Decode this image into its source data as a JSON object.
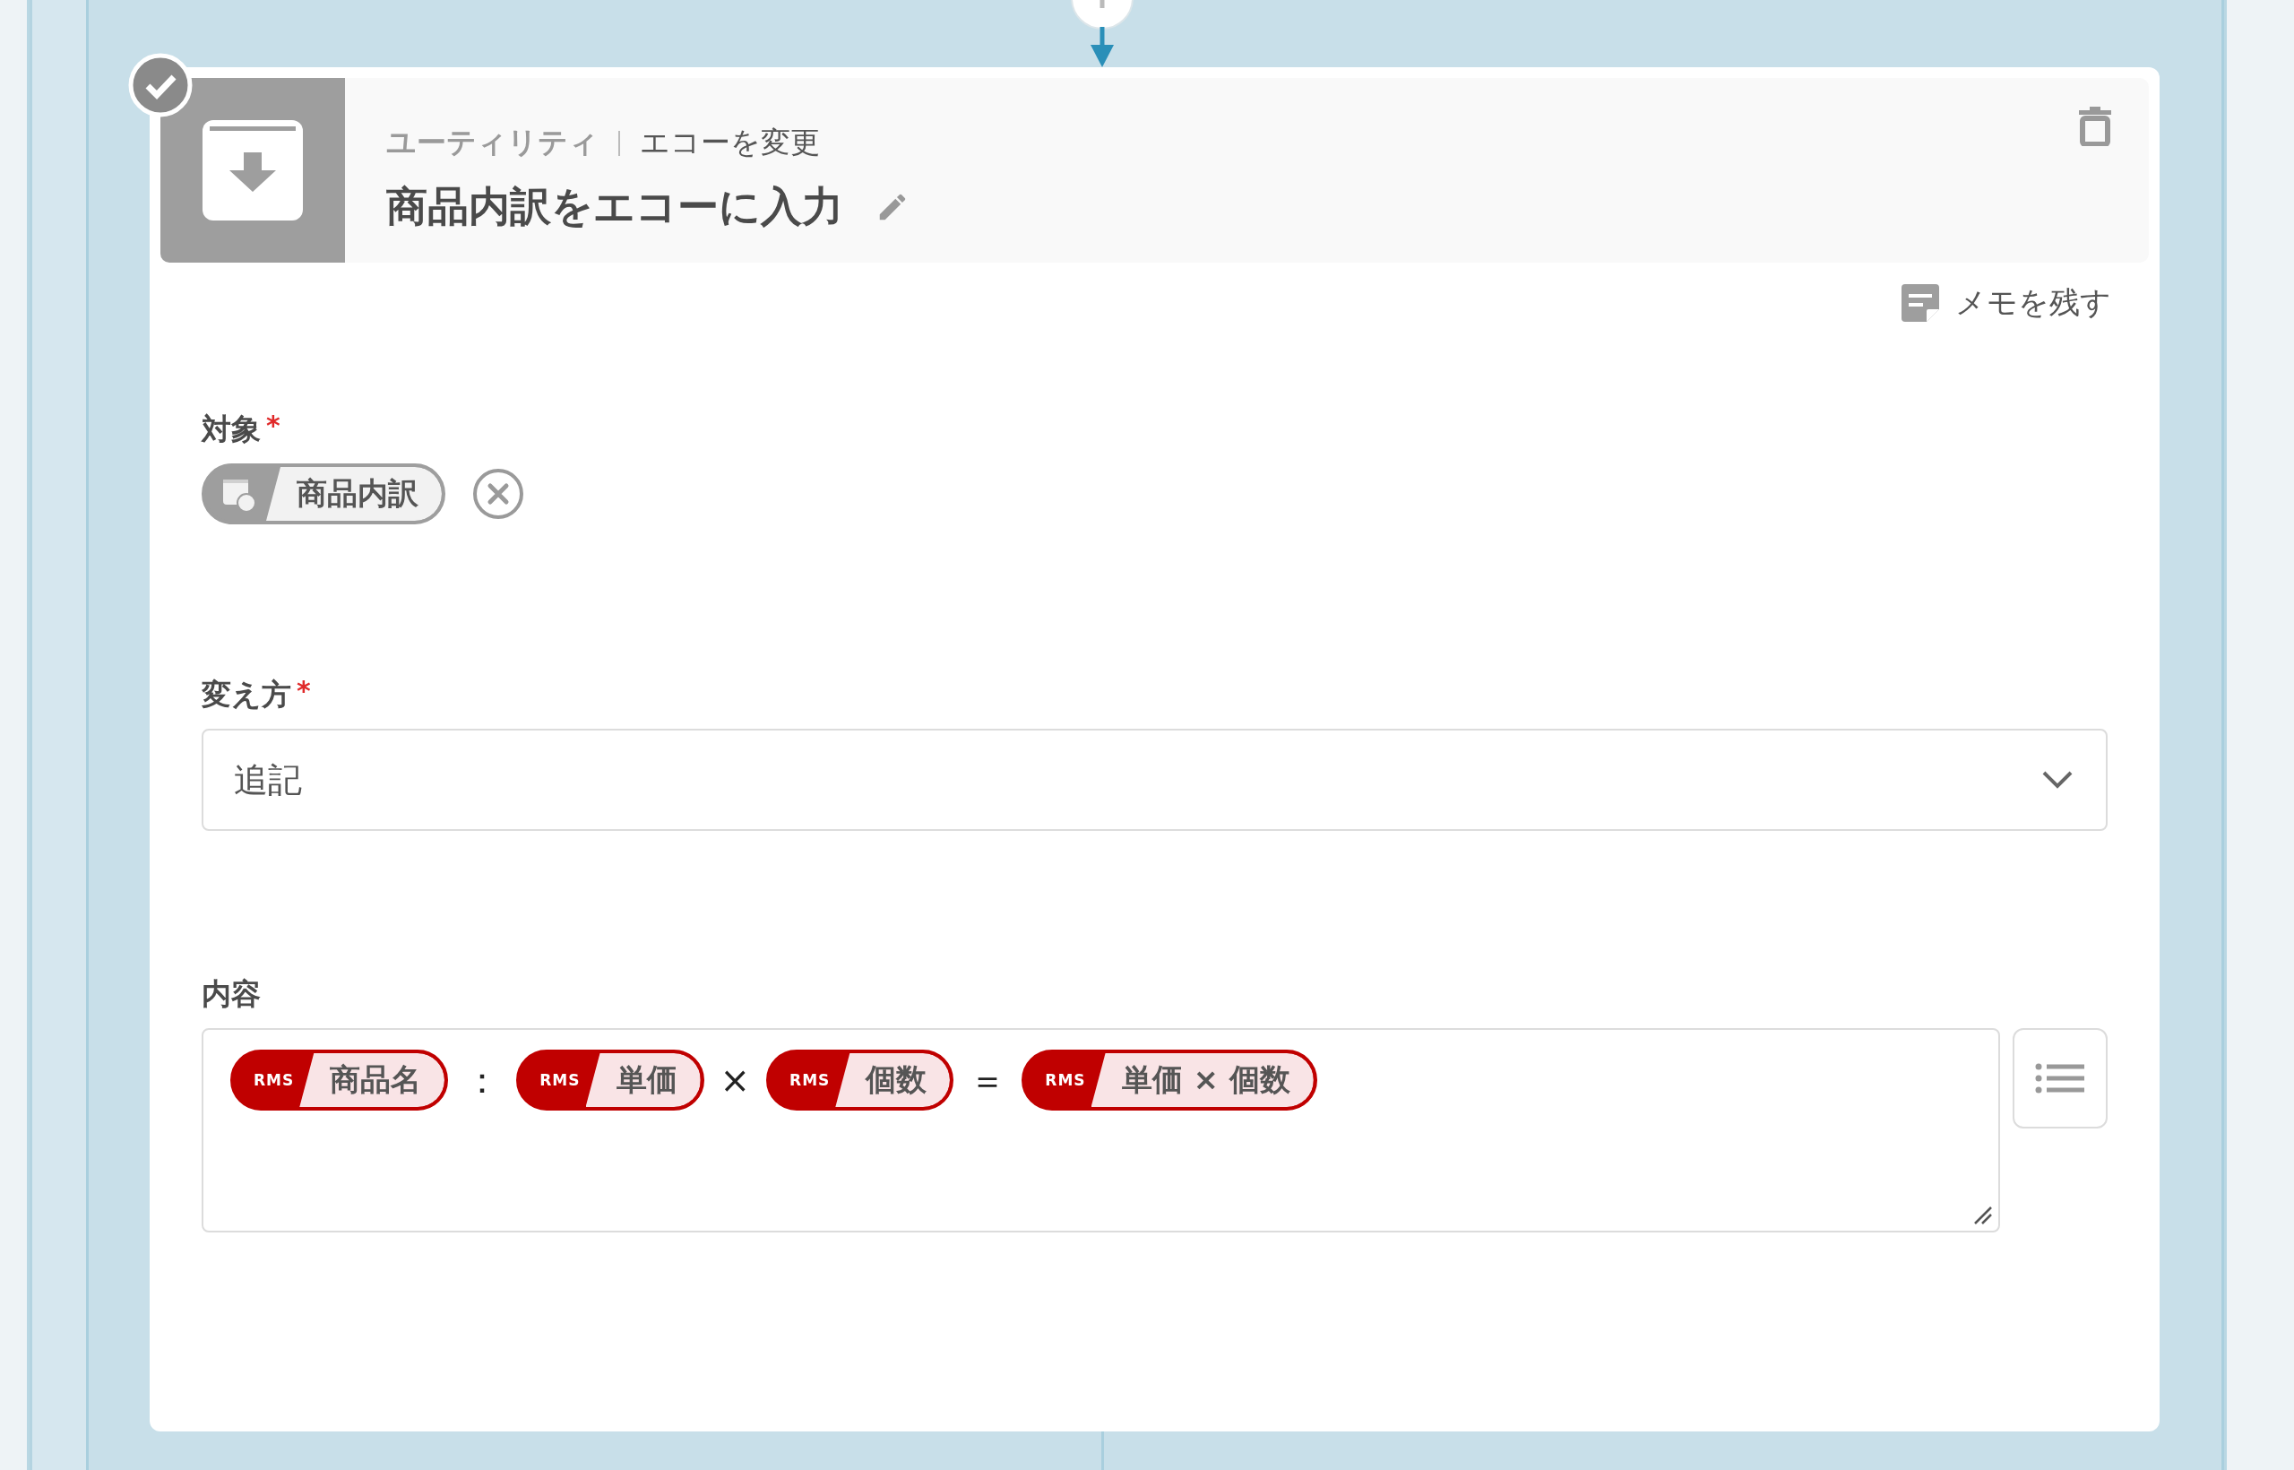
{
  "step": {
    "verified": true,
    "category": "ユーティリティ",
    "action": "エコーを変更",
    "title": "商品内訳をエコーに入力"
  },
  "memo_button": "メモを残す",
  "fields": [
    {
      "kind": "target",
      "label": "対象",
      "required_mark": "*",
      "chip": {
        "label": "商品内訳"
      }
    },
    {
      "kind": "select",
      "label": "変え方",
      "required_mark": "*",
      "value": "追記"
    },
    {
      "kind": "content",
      "label": "内容",
      "items": [
        {
          "kind": "chip",
          "badge": "RMS",
          "label": "商品名"
        },
        {
          "kind": "text",
          "text": "："
        },
        {
          "kind": "chip",
          "badge": "RMS",
          "label": "単価"
        },
        {
          "kind": "text",
          "text": "×"
        },
        {
          "kind": "chip",
          "badge": "RMS",
          "label": "個数"
        },
        {
          "kind": "text",
          "text": "＝"
        },
        {
          "kind": "chip",
          "badge": "RMS",
          "label": "単価 × 個数"
        }
      ]
    }
  ]
}
